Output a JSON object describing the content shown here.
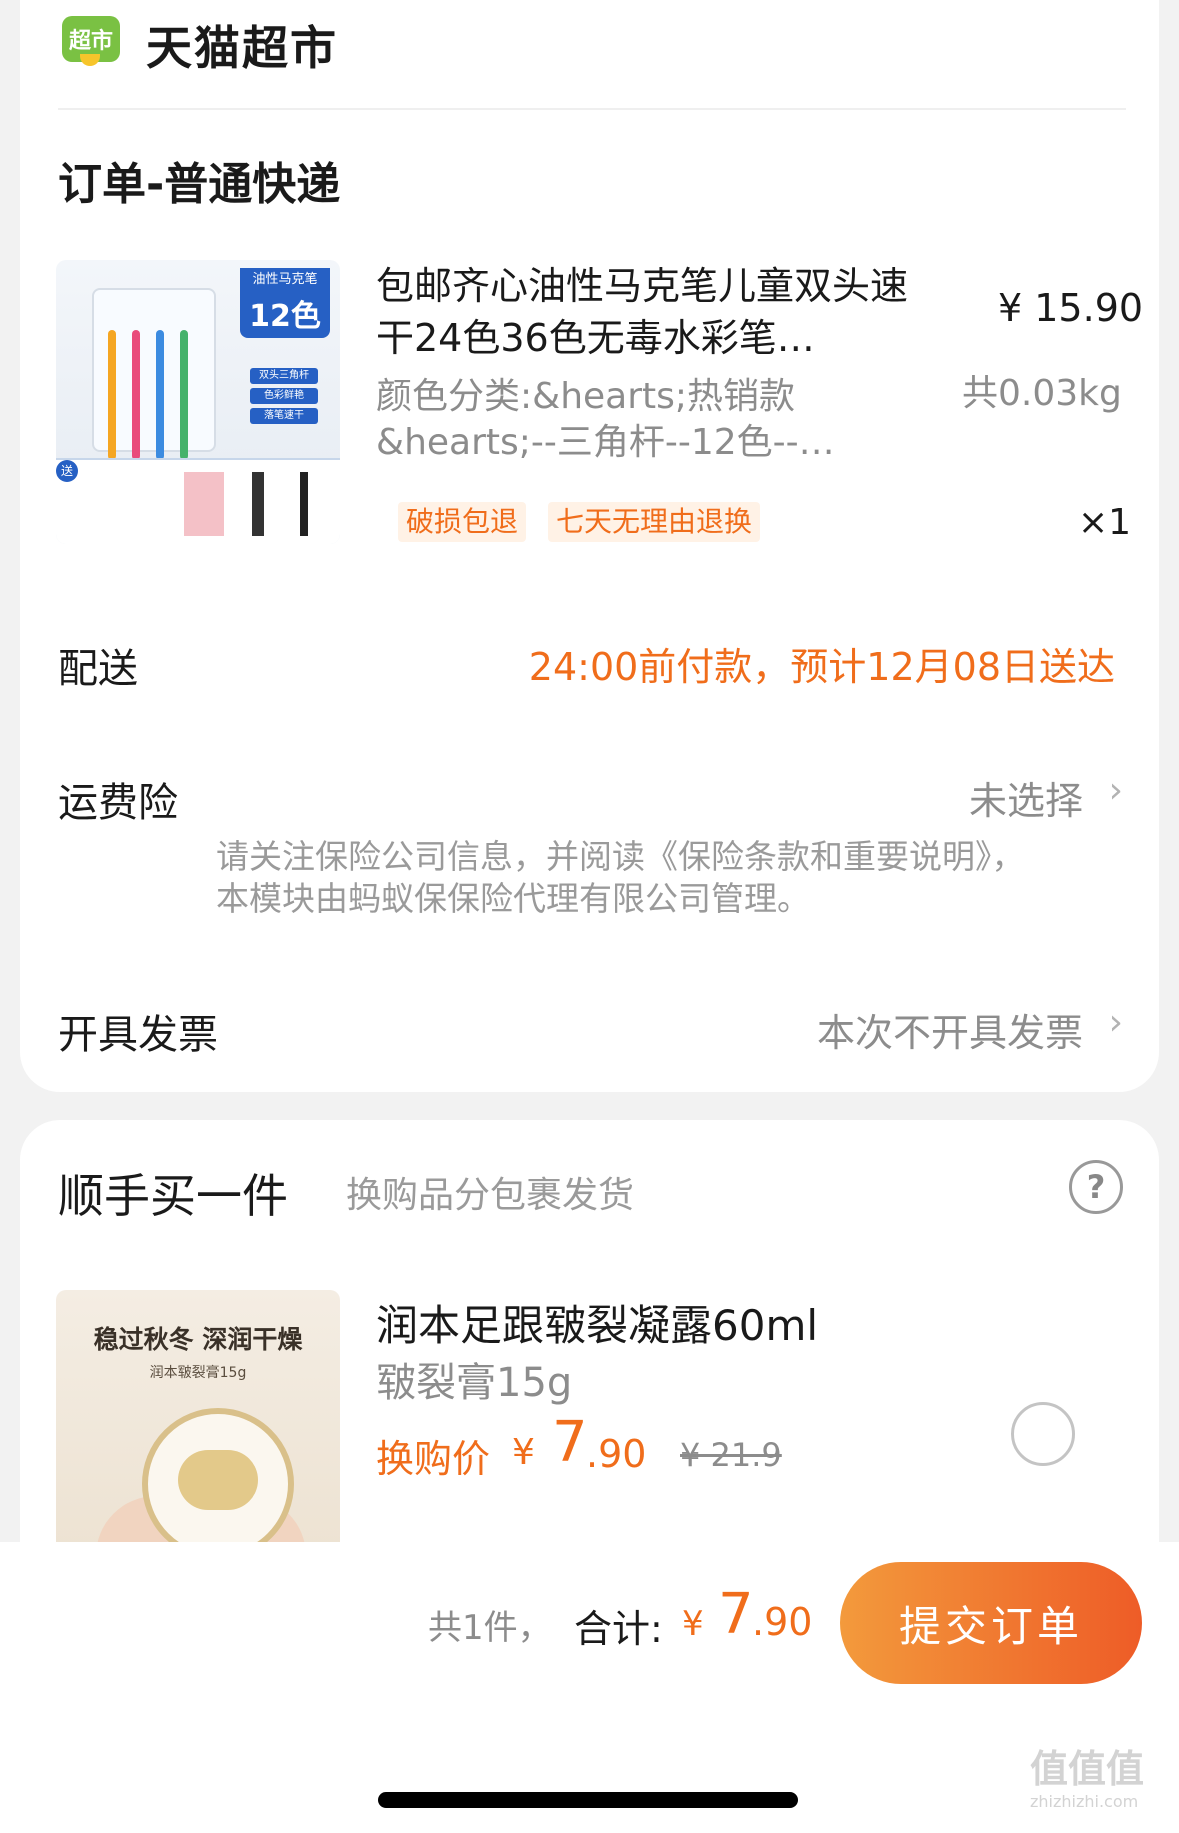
{
  "header": {
    "logo_text": "超市",
    "brand": "天猫超市"
  },
  "order": {
    "title": "订单-普通快递",
    "item": {
      "thumb_texts": {
        "type": "油性马克笔",
        "count": "12色",
        "pill1": "双头三角杆",
        "pill2": "色彩鲜艳",
        "pill3": "落笔速干",
        "gift": "送"
      },
      "title": "包邮齐心油性马克笔儿童双头速干24色36色无毒水彩笔…",
      "price": "¥ 15.90",
      "spec": "颜色分类:&hearts;热销款&hearts;--三角杆--12色--…",
      "weight": "共0.03kg",
      "tags": [
        "破损包退",
        "七天无理由退换"
      ],
      "qty": "×1"
    },
    "delivery": {
      "label": "配送",
      "value": "24:00前付款，预计12月08日送达"
    },
    "insurance": {
      "label": "运费险",
      "value": "未选择",
      "note": "请关注保险公司信息，并阅读《保险条款和重要说明》，本模块由蚂蚁保保险代理有限公司管理。"
    },
    "invoice": {
      "label": "开具发票",
      "value": "本次不开具发票"
    }
  },
  "addon": {
    "title": "顺手买一件",
    "subtitle": "换购品分包裹发货",
    "help": "?",
    "item": {
      "thumb_texts": {
        "headline": "稳过秋冬 深润干燥",
        "sub": "润本皲裂膏15g"
      },
      "title": "润本足跟皲裂凝露60ml",
      "spec": "皲裂膏15g",
      "price_label": "换购价",
      "currency": "¥",
      "price_int": "7",
      "price_dec": ".90",
      "orig_price": "¥ 21.9",
      "selected": false
    }
  },
  "summary": {
    "count": "共1件，",
    "label": "合计:",
    "currency": "¥",
    "total_int": "7",
    "total_dec": ".90",
    "submit": "提交订单"
  },
  "watermark": {
    "text": "值值值",
    "sub": "zhizhizhi.com"
  },
  "colors": {
    "accent": "#f06d1b",
    "brand_green": "#7ac143"
  }
}
